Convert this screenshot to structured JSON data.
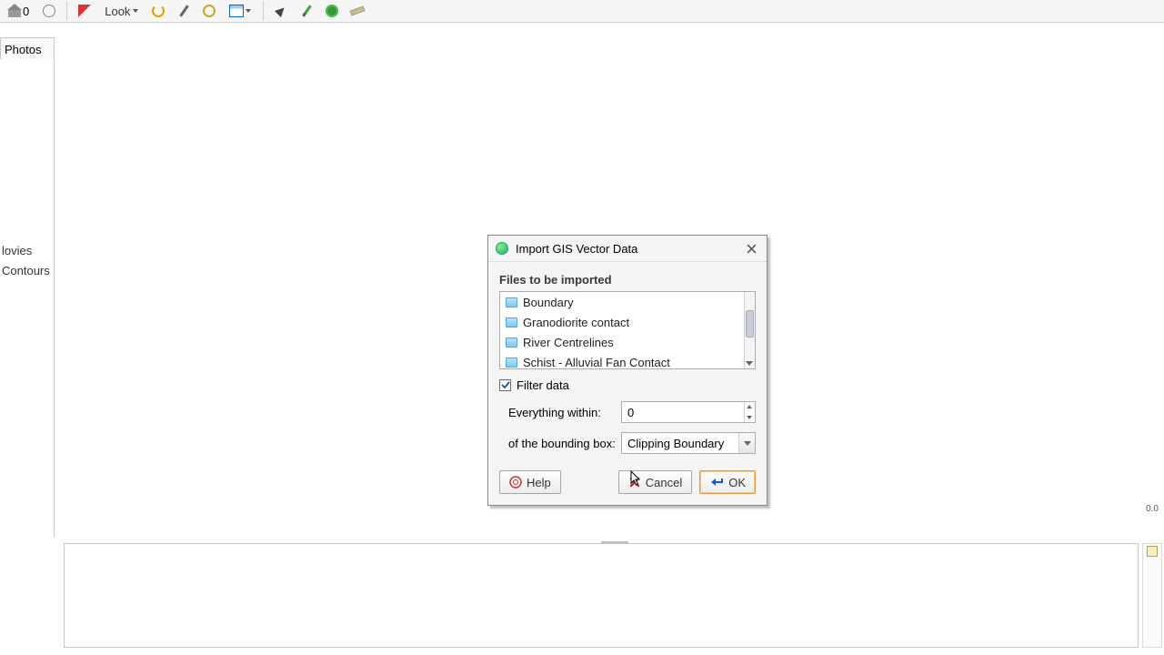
{
  "toolbar": {
    "home_badge": "0",
    "look_label": "Look"
  },
  "sidebar": {
    "tab_label": "Photos",
    "items": [
      "lovies",
      "Contours"
    ]
  },
  "axis": {
    "origin": "0.0"
  },
  "dialog": {
    "title": "Import GIS Vector Data",
    "section": "Files to be imported",
    "files": [
      "Boundary",
      "Granodiorite contact",
      "River Centrelines",
      "Schist - Alluvial Fan Contact"
    ],
    "filter_checked": true,
    "filter_label": "Filter data",
    "within_label": "Everything within:",
    "within_value": "0",
    "bbox_label": "of the bounding box:",
    "bbox_value": "Clipping Boundary",
    "buttons": {
      "help": "Help",
      "cancel": "Cancel",
      "ok": "OK"
    }
  }
}
